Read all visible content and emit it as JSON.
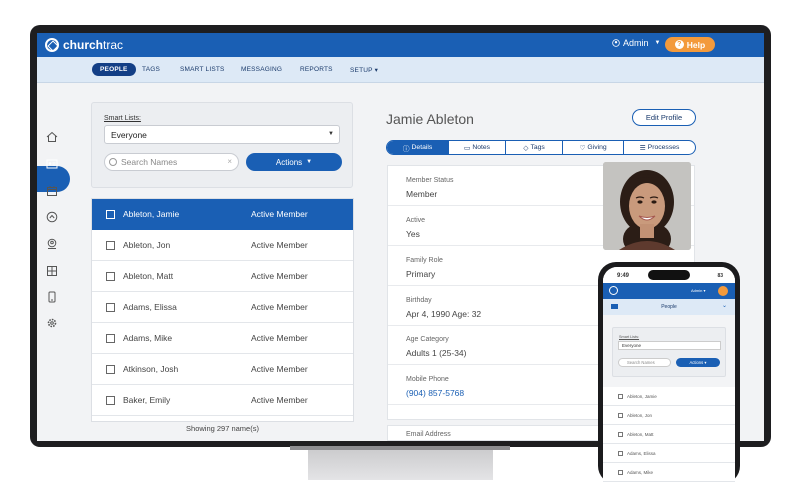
{
  "app": {
    "logo_bold": "church",
    "logo_light": "trac",
    "admin_label": "Admin",
    "help_label": "Help"
  },
  "nav": [
    "PEOPLE",
    "TAGS",
    "SMART LISTS",
    "MESSAGING",
    "REPORTS",
    "SETUP"
  ],
  "smart_lists": {
    "label": "Smart Lists:",
    "selected": "Everyone",
    "search_placeholder": "Search Names",
    "actions_label": "Actions"
  },
  "people": [
    {
      "name": "Ableton, Jamie",
      "status": "Active Member"
    },
    {
      "name": "Ableton, Jon",
      "status": "Active Member"
    },
    {
      "name": "Ableton, Matt",
      "status": "Active Member"
    },
    {
      "name": "Adams, Elissa",
      "status": "Active Member"
    },
    {
      "name": "Adams, Mike",
      "status": "Active Member"
    },
    {
      "name": "Atkinson, Josh",
      "status": "Active Member"
    },
    {
      "name": "Baker, Emily",
      "status": "Active Member"
    }
  ],
  "showing": "Showing 297 name(s)",
  "profile": {
    "name": "Jamie Ableton",
    "edit_label": "Edit Profile",
    "tabs": [
      "Details",
      "Notes",
      "Tags",
      "Giving",
      "Processes"
    ],
    "fields": [
      {
        "label": "Member Status",
        "value": "Member"
      },
      {
        "label": "Active",
        "value": "Yes"
      },
      {
        "label": "Family Role",
        "value": "Primary"
      },
      {
        "label": "Birthday",
        "value": "Apr 4, 1990 Age: 32"
      },
      {
        "label": "Age Category",
        "value": "Adults 1 (25-34)"
      },
      {
        "label": "Mobile Phone",
        "value": "(904) 857-5768"
      }
    ],
    "email_label": "Email Address"
  },
  "phone": {
    "time": "9:49",
    "battery": "83",
    "admin_label": "Admin",
    "section": "People",
    "smart_lists_label": "Smart Lists:",
    "selected": "Everyone",
    "search_placeholder": "Search Names",
    "actions_label": "Actions",
    "people": [
      "Ableton, Jamie",
      "Ableton, Jon",
      "Ableton, Matt",
      "Adams, Elissa",
      "Adams, Mike"
    ]
  },
  "colors": {
    "brand_blue": "#1a5fb4",
    "help_orange": "#f39a3c",
    "nav_bg": "#dde9f6"
  }
}
